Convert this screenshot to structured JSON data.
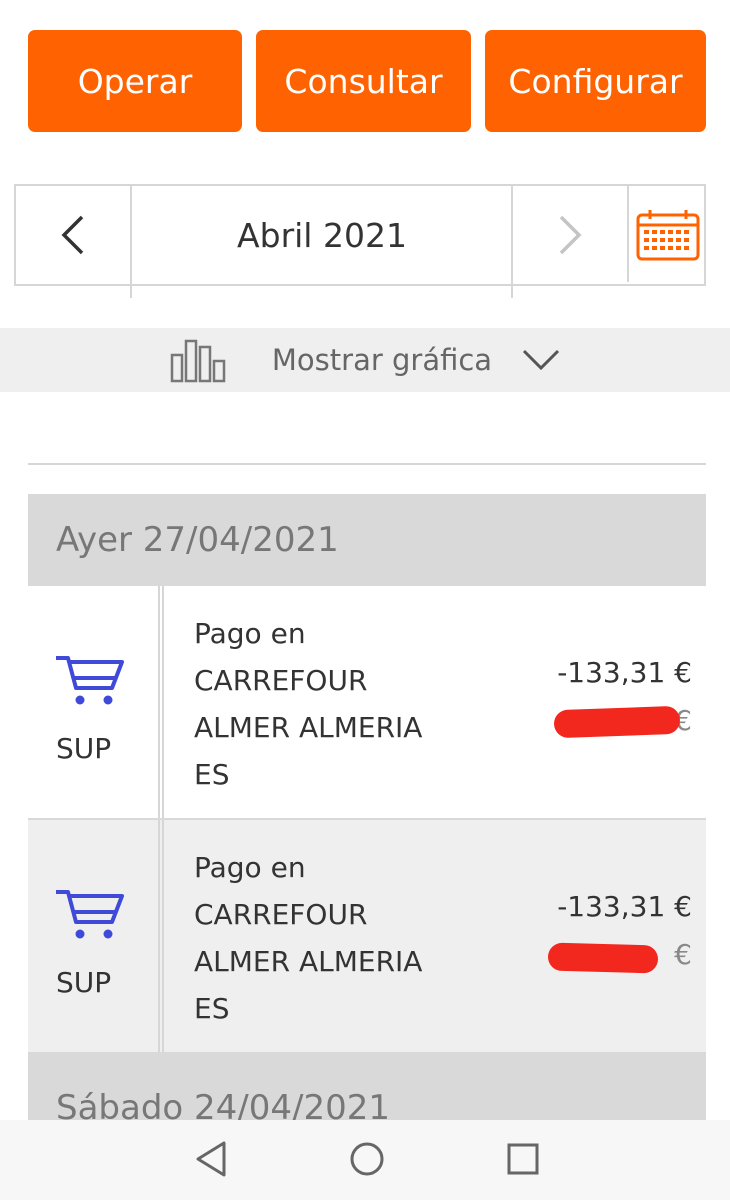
{
  "top_buttons": {
    "operar": "Operar",
    "consultar": "Consultar",
    "configurar": "Configurar"
  },
  "month_nav": {
    "current_month": "Abril 2021",
    "prev_icon": "chevron-left-icon",
    "next_icon": "chevron-right-icon",
    "calendar_icon": "calendar-icon"
  },
  "graph_toggle": {
    "label": "Mostrar gráfica",
    "icon": "bar-chart-icon",
    "expand_icon": "chevron-down-icon"
  },
  "days": [
    {
      "header": "Ayer 27/04/2021",
      "transactions": [
        {
          "category": "SUP",
          "category_icon": "shopping-cart-icon",
          "desc_lines": [
            "Pago en",
            "CARREFOUR",
            "ALMER ALMERIA",
            "ES"
          ],
          "amount": "-133,31 €",
          "balance_currency": "€"
        },
        {
          "category": "SUP",
          "category_icon": "shopping-cart-icon",
          "desc_lines": [
            "Pago en",
            "CARREFOUR",
            "ALMER ALMERIA",
            "ES"
          ],
          "amount": "-133,31 €",
          "balance_currency": "€"
        }
      ]
    },
    {
      "header": "Sábado 24/04/2021",
      "transactions": []
    }
  ],
  "colors": {
    "brand_orange": "#ff6200",
    "cart_blue": "#3f4bd8",
    "redaction_red": "#f2281f"
  },
  "android_nav": {
    "back_icon": "back-triangle-icon",
    "home_icon": "home-circle-icon",
    "recents_icon": "recents-square-icon"
  }
}
